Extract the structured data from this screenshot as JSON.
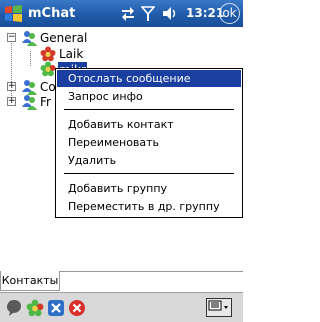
{
  "titlebar": {
    "app_title": "mChat",
    "time": "13:21",
    "ok_label": "ok"
  },
  "tree": {
    "groups": [
      {
        "label": "General",
        "expanded": true,
        "toggle": "−"
      },
      {
        "label": "Co",
        "expanded": false,
        "toggle": "+"
      },
      {
        "label": "Fr",
        "expanded": false,
        "toggle": "+"
      }
    ],
    "contacts": [
      {
        "label": "Laik",
        "status_icon": "flower-online-icon"
      },
      {
        "label": "mikr",
        "status_icon": "flower-online-icon",
        "selected": true
      }
    ]
  },
  "context_menu": {
    "items": [
      {
        "label": "Отослать сообщение",
        "selected": true
      },
      {
        "label": "Запрос инфо"
      },
      {
        "label": "Добавить контакт"
      },
      {
        "label": "Переименовать"
      },
      {
        "label": "Удалить"
      },
      {
        "label": "Добавить группу"
      },
      {
        "label": "Переместить  в др. группу"
      }
    ]
  },
  "tabs": [
    {
      "label": "Контакты",
      "active": true
    }
  ],
  "toolbar": {
    "icons": [
      "status-icon",
      "online-flower-icon",
      "settings-icon",
      "close-icon",
      "keyboard-icon"
    ]
  },
  "colors": {
    "titlebar": "#1f5aa8",
    "menu_highlight": "#1b3fa0",
    "toolbar_bg": "#d8d8d8"
  }
}
